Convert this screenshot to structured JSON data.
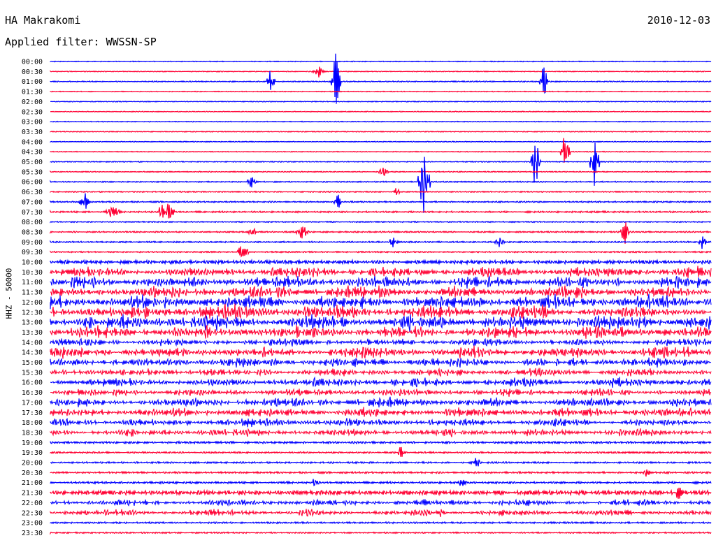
{
  "header": {
    "station": "HA Makrakomi",
    "date": "2010-12-03",
    "filter_label": "Applied filter: WWSSN-SP",
    "channel_label": "HHZ - 50000"
  },
  "helicorder": {
    "row_times": [
      "00:00",
      "00:30",
      "01:00",
      "01:30",
      "02:00",
      "02:30",
      "03:00",
      "03:30",
      "04:00",
      "04:30",
      "05:00",
      "05:30",
      "06:00",
      "06:30",
      "07:00",
      "07:30",
      "08:00",
      "08:30",
      "09:00",
      "09:30",
      "10:00",
      "10:30",
      "11:00",
      "11:30",
      "12:00",
      "12:30",
      "13:00",
      "13:30",
      "14:00",
      "14:30",
      "15:00",
      "15:30",
      "16:00",
      "16:30",
      "17:00",
      "17:30",
      "18:00",
      "18:30",
      "19:00",
      "19:30",
      "20:00",
      "20:30",
      "21:00",
      "21:30",
      "22:00",
      "22:30",
      "23:00",
      "23:30"
    ],
    "trace_colors": [
      "#0000ff",
      "#ff0033"
    ]
  }
}
